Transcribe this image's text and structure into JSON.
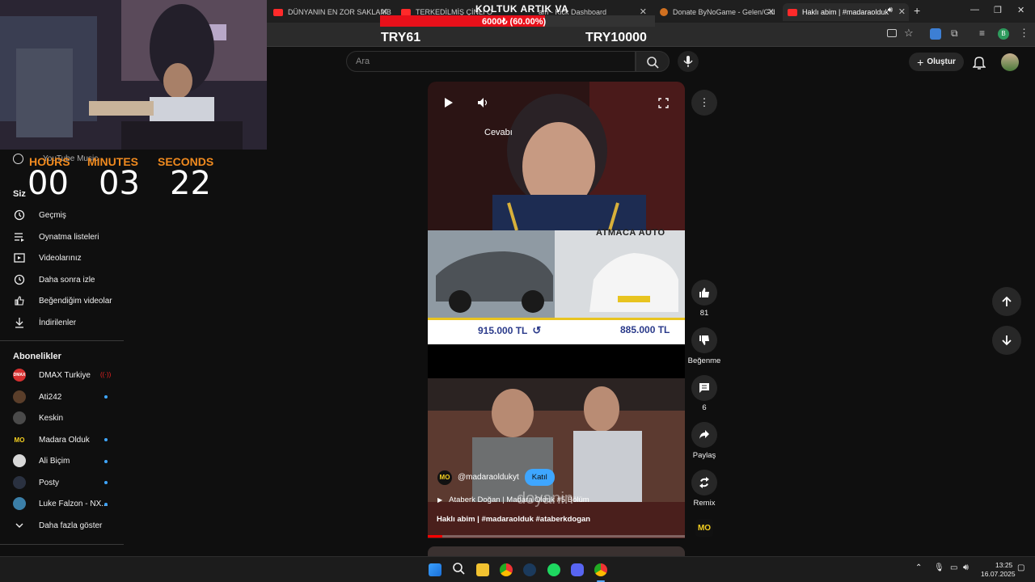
{
  "browser": {
    "tabs": [
      {
        "title": "DÜNYANIN EN ZOR SAKLAMBA"
      },
      {
        "title": "TERKEDİLMİŞ ÇİNLİ O"
      },
      {
        "title": "am - Kick Dashboard"
      },
      {
        "title": "Donate ByNoGame - Gelen/Gid"
      },
      {
        "title": "Haklı abim | #madaraolduk"
      }
    ]
  },
  "overlay": {
    "donation_title": "KOLTUK ARTIK VA",
    "donation_progress_text": "6000₺ (60.00%)",
    "donation_progress": 0.6,
    "donation_current": "TRY61",
    "donation_goal": "TRY10000",
    "timer": {
      "labels": [
        "HOURS",
        "MINUTES",
        "SECONDS"
      ],
      "values": [
        "00",
        "03",
        "22"
      ]
    }
  },
  "youtube": {
    "search_placeholder": "Ara",
    "create_label": "Oluştur",
    "sidebar": {
      "music_label": "YouTube Music",
      "you_label": "Siz",
      "items": [
        {
          "label": "Geçmiş"
        },
        {
          "label": "Oynatma listeleri"
        },
        {
          "label": "Videolarınız"
        },
        {
          "label": "Daha sonra izle"
        },
        {
          "label": "Beğendiğim videolar"
        },
        {
          "label": "İndirilenler"
        }
      ],
      "subs_title": "Abonelikler",
      "subs": [
        {
          "label": "DMAX Turkiye",
          "badge": "DMAX"
        },
        {
          "label": "Ati242",
          "badge": ""
        },
        {
          "label": "Keskin",
          "badge": ""
        },
        {
          "label": "Madara Olduk",
          "badge": "MO"
        },
        {
          "label": "Ali Biçim",
          "badge": ""
        },
        {
          "label": "Posty",
          "badge": ""
        },
        {
          "label": "Luke Falzon - NX...",
          "badge": ""
        }
      ],
      "more_label": "Daha fazla göster"
    },
    "short": {
      "overlay_text": "Cevabı",
      "dealer_text": "ATMACA AUTO",
      "price_left": "915.000 TL",
      "price_right": "885.000 TL",
      "watermark": "doyanin",
      "channel_handle": "@madaraoldukyt",
      "join_label": "Katıl",
      "music_text": "Ataberk Doğan | Madara Olduk #5 Bölüm",
      "title": "Haklı abim | #madaraolduk #ataberkdogan"
    },
    "actions": {
      "likes": "81",
      "dislike_label": "Beğenme",
      "comments": "6",
      "share_label": "Paylaş",
      "remix_label": "Remix"
    }
  },
  "taskbar": {
    "time": "13:25",
    "date": "16.07.2025"
  }
}
